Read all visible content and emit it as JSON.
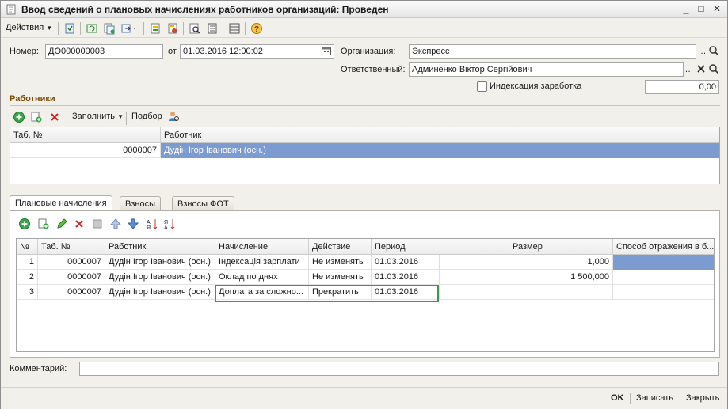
{
  "window": {
    "title": "Ввод сведений о плановых начислениях работников организаций: Проведен",
    "controls": [
      "_",
      "□",
      "✕"
    ]
  },
  "toolbar": {
    "actions_label": "Действия",
    "icons": [
      "post-doc-icon",
      "refresh-icon",
      "copy-doc-icon",
      "structure-icon",
      "create-based-icon",
      "post-icon",
      "unpost-icon",
      "preview-icon",
      "journal-icon",
      "list-settings-icon",
      "help-icon"
    ]
  },
  "header": {
    "number_label": "Номер:",
    "number_value": "ДО000000003",
    "date_label": "от",
    "date_value": "01.03.2016 12:00:02",
    "org_label": "Организация:",
    "org_value": "Экспресс",
    "responsible_label": "Ответственный:",
    "responsible_value": "Админенко Віктор Сергійович",
    "indexation_label": "Индексация заработка",
    "indexation_checked": false,
    "amount_value": "0,00"
  },
  "workers": {
    "section_title": "Работники",
    "fill_label": "Заполнить",
    "pick_label": "Подбор",
    "columns": [
      "Таб. №",
      "Работник"
    ],
    "rows": [
      {
        "tab": "0000007",
        "worker": "Дудін Ігор Іванович (осн.)",
        "selected": true
      }
    ]
  },
  "tabs": [
    {
      "label": "Плановые начисления",
      "active": true
    },
    {
      "label": "Взносы",
      "active": false
    },
    {
      "label": "Взносы ФОТ",
      "active": false
    }
  ],
  "accruals": {
    "columns": [
      "№",
      "Таб. №",
      "Работник",
      "Начисление",
      "Действие",
      "Период",
      "",
      "Размер",
      "Способ отражения в б..."
    ],
    "rows": [
      {
        "n": "1",
        "tab": "0000007",
        "worker": "Дудін Ігор Іванович (осн.)",
        "accrual": "Індексація зарплати",
        "action": "Не изменять",
        "period": "01.03.2016",
        "extra": "",
        "size": "1,000",
        "method": ""
      },
      {
        "n": "2",
        "tab": "0000007",
        "worker": "Дудін Ігор Іванович (осн.)",
        "accrual": "Оклад по днях",
        "action": "Не изменять",
        "period": "01.03.2016",
        "extra": "",
        "size": "1 500,000",
        "method": ""
      },
      {
        "n": "3",
        "tab": "0000007",
        "worker": "Дудін Ігор Іванович (осн.)",
        "accrual": "Доплата за сложно...",
        "action": "Прекратить",
        "period": "01.03.2016",
        "extra": "",
        "size": "",
        "method": ""
      }
    ]
  },
  "comment": {
    "label": "Комментарий:",
    "value": ""
  },
  "footer": {
    "ok_label": "OK",
    "save_label": "Записать",
    "close_label": "Закрыть"
  },
  "colors": {
    "selection": "#7c9bd1",
    "highlight": "#2ca04f",
    "section_title": "#7a4a00"
  }
}
